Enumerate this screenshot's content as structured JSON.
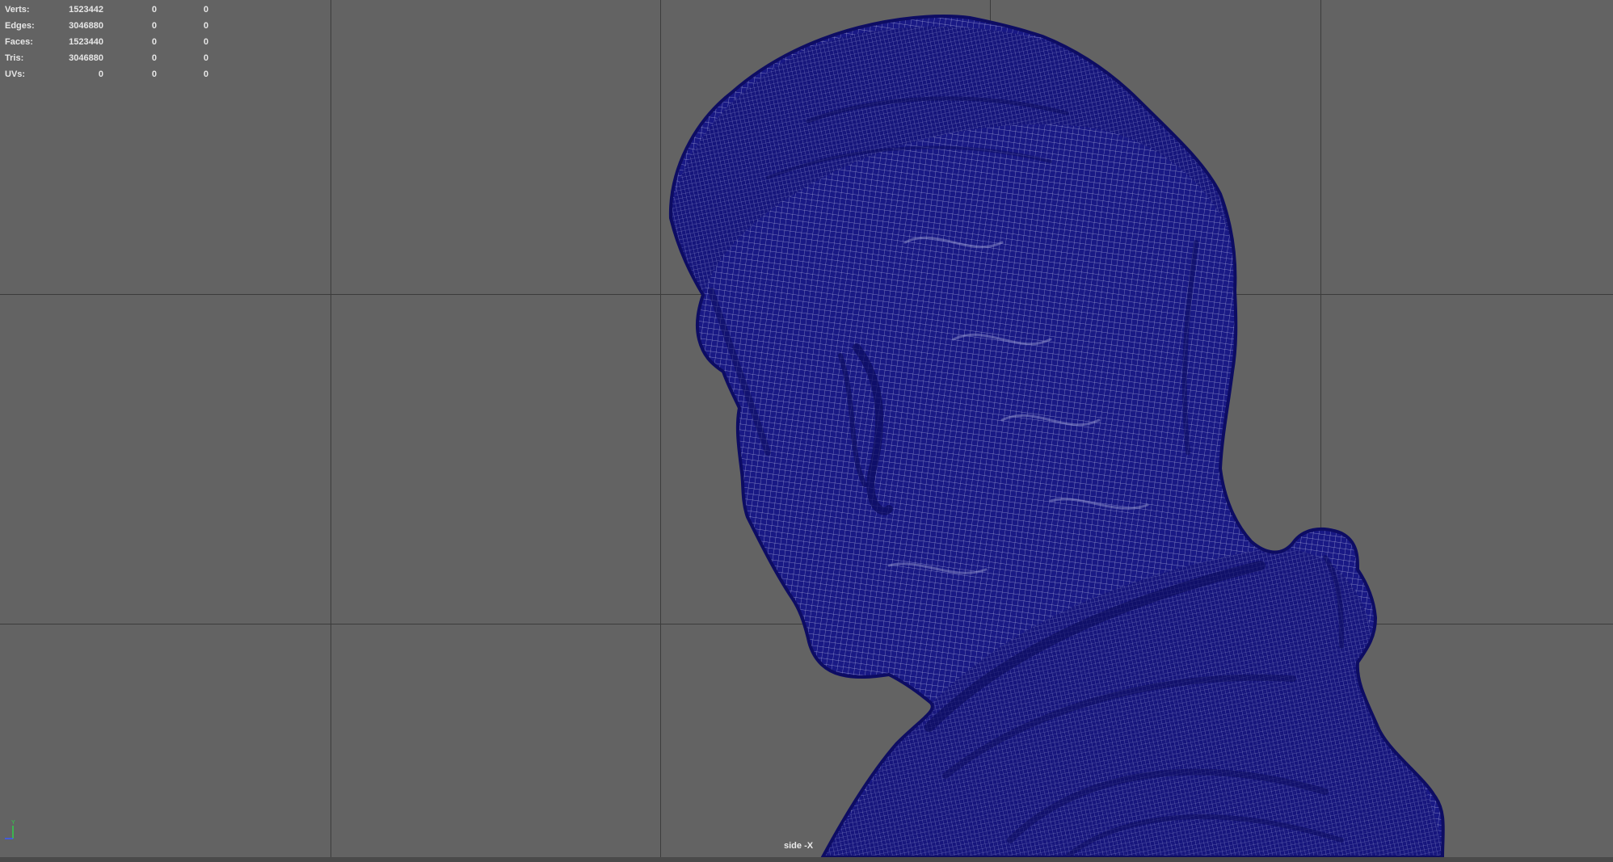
{
  "hud": {
    "rows": [
      {
        "label": "Verts:",
        "total": "1523442",
        "selected": "0",
        "uv": "0"
      },
      {
        "label": "Edges:",
        "total": "3046880",
        "selected": "0",
        "uv": "0"
      },
      {
        "label": "Faces:",
        "total": "1523440",
        "selected": "0",
        "uv": "0"
      },
      {
        "label": "Tris:",
        "total": "3046880",
        "selected": "0",
        "uv": "0"
      },
      {
        "label": "UVs:",
        "total": "0",
        "selected": "0",
        "uv": "0"
      }
    ]
  },
  "camera": {
    "label": "side -X"
  },
  "axis": {
    "y_label": "Y"
  },
  "colors": {
    "viewport_bg": "#636363",
    "grid": "#3c3c3c",
    "mesh_fill": "#16157e",
    "mesh_wire": "#c9cbe6"
  }
}
